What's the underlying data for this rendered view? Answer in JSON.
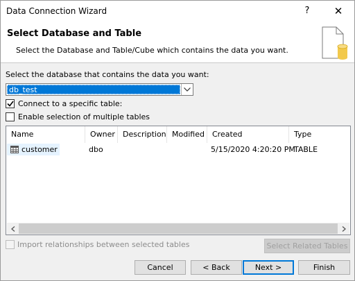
{
  "window": {
    "title": "Data Connection Wizard",
    "help": "?",
    "close": "✕"
  },
  "header": {
    "title": "Select Database and Table",
    "subtitle": "Select the Database and Table/Cube which contains the data you want."
  },
  "database": {
    "label": "Select the database that contains the data you want:",
    "selected": "db_test"
  },
  "options": {
    "connect_specific": {
      "label": "Connect to a specific table:",
      "checked": true
    },
    "enable_multiple": {
      "label": "Enable selection of multiple tables",
      "checked": false
    }
  },
  "table": {
    "columns": [
      "Name",
      "Owner",
      "Description",
      "Modified",
      "Created",
      "Type"
    ],
    "rows": [
      {
        "name": "customer",
        "owner": "dbo",
        "description": "",
        "modified": "",
        "created": "5/15/2020 4:20:20 PM",
        "type": "TABLE"
      }
    ]
  },
  "import_relationships": {
    "label": "Import relationships between selected tables",
    "checked": false
  },
  "buttons": {
    "select_related": "Select Related Tables",
    "cancel": "Cancel",
    "back": "< Back",
    "next": "Next >",
    "finish": "Finish"
  },
  "colors": {
    "accent": "#0078d7",
    "row_hover": "#e5f3ff"
  }
}
